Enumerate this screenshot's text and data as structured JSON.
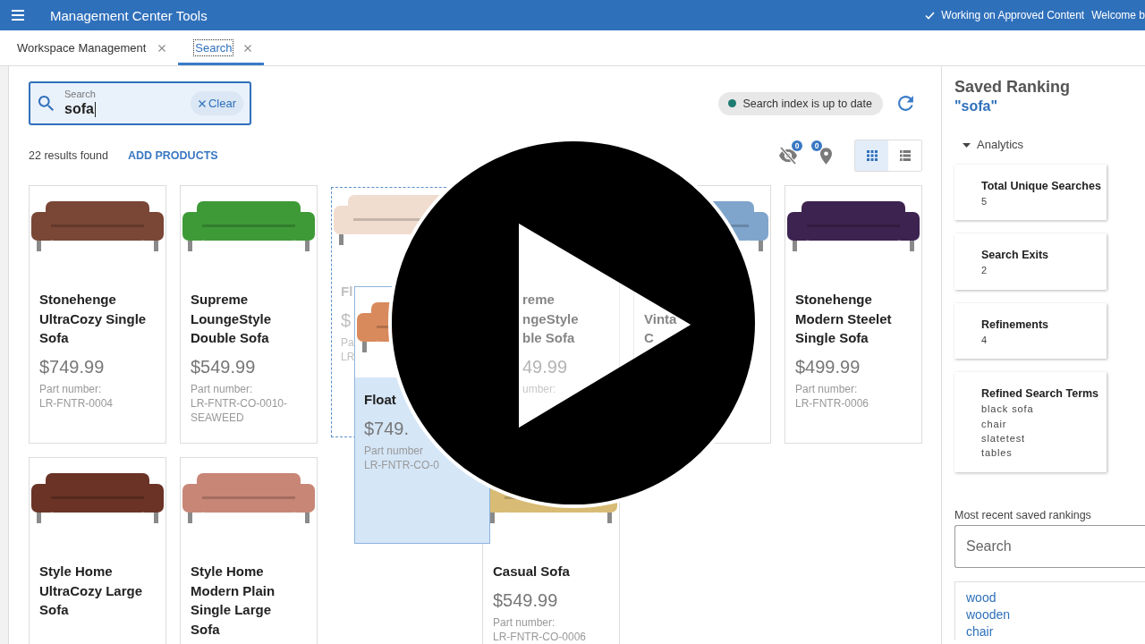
{
  "header": {
    "title": "Management Center Tools",
    "status": "Working on Approved Content",
    "greeting": "Welcome b"
  },
  "tabs": [
    {
      "label": "Workspace Management",
      "selected": false
    },
    {
      "label": "Search",
      "selected": true
    }
  ],
  "search": {
    "label": "Search",
    "value": "sofa",
    "focused": true,
    "clear_label": "Clear"
  },
  "index_status": {
    "text": "Search index is up to date",
    "color": "#1e7b70"
  },
  "results": {
    "count": "22 results found",
    "action": "ADD PRODUCTS"
  },
  "toolbar": {
    "hidden_count": "0",
    "pinned_count": "0",
    "views": [
      {
        "kind": "grid",
        "selected": true
      },
      {
        "kind": "list",
        "selected": false
      }
    ]
  },
  "products": [
    {
      "kind": "product",
      "title": "Stonehenge UltraCozy Single Sofa",
      "price": "$749.99",
      "part_label": "Part number:",
      "part_number": "LR-FNTR-0004",
      "color": "#7a4636"
    },
    {
      "kind": "product",
      "title": "Supreme LoungeStyle Double Sofa",
      "price": "$549.99",
      "part_label": "Part number:",
      "part_number": "LR-FNTR-CO-0010-SEAWEED",
      "color": "#3e9a37"
    },
    {
      "kind": "drop-placeholder",
      "title": "Fl",
      "price": "$",
      "part_label": "Pa",
      "part_number": "LR",
      "color": "#f1ddd0"
    },
    {
      "kind": "cut-left",
      "title_fragments": [
        "reme",
        "ngeStyle",
        "ble Sofa"
      ],
      "price": "49.99",
      "part_label": "umber:"
    },
    {
      "kind": "cut-right",
      "title_fragments": [
        "Vinta",
        "C"
      ],
      "color": "#7fa5cc"
    },
    {
      "kind": "product",
      "title": "Stonehenge Modern Steelet Single Sofa",
      "price": "$499.99",
      "part_label": "Part number:",
      "part_number": "LR-FNTR-0006",
      "color": "#3d2350"
    },
    {
      "kind": "product",
      "title": "Style Home UltraCozy Large Sofa",
      "color": "#6a3326"
    },
    {
      "kind": "product",
      "title": "Style Home Modern Plain Single Large Sofa",
      "color": "#c88676"
    },
    {
      "kind": "drag-source"
    },
    {
      "kind": "product",
      "title": "Casual Sofa",
      "price": "$549.99",
      "part_label": "Part number:",
      "part_number": "LR-FNTR-CO-0006",
      "color": "#d8bb74"
    }
  ],
  "drag_preview": {
    "title": "Float",
    "price": "$749.",
    "part_label": "Part number",
    "part_number": "LR-FNTR-CO-0",
    "color": "#d98a5c"
  },
  "panel": {
    "title": "Saved Ranking",
    "query": "\"sofa\"",
    "section": {
      "label": "Analytics",
      "expanded": true
    },
    "metrics": [
      {
        "label": "Total Unique Searches",
        "values": [
          "5"
        ]
      },
      {
        "label": "Search Exits",
        "values": [
          "2"
        ]
      },
      {
        "label": "Refinements",
        "values": [
          "4"
        ]
      },
      {
        "label": "Refined Search Terms",
        "values": [
          "black sofa",
          "chair",
          "slatetest",
          "tables"
        ]
      }
    ],
    "recent_label": "Most recent saved rankings",
    "search_placeholder": "Search",
    "recent": [
      "wood",
      "wooden",
      "chair"
    ]
  },
  "video": {
    "paused": true
  }
}
